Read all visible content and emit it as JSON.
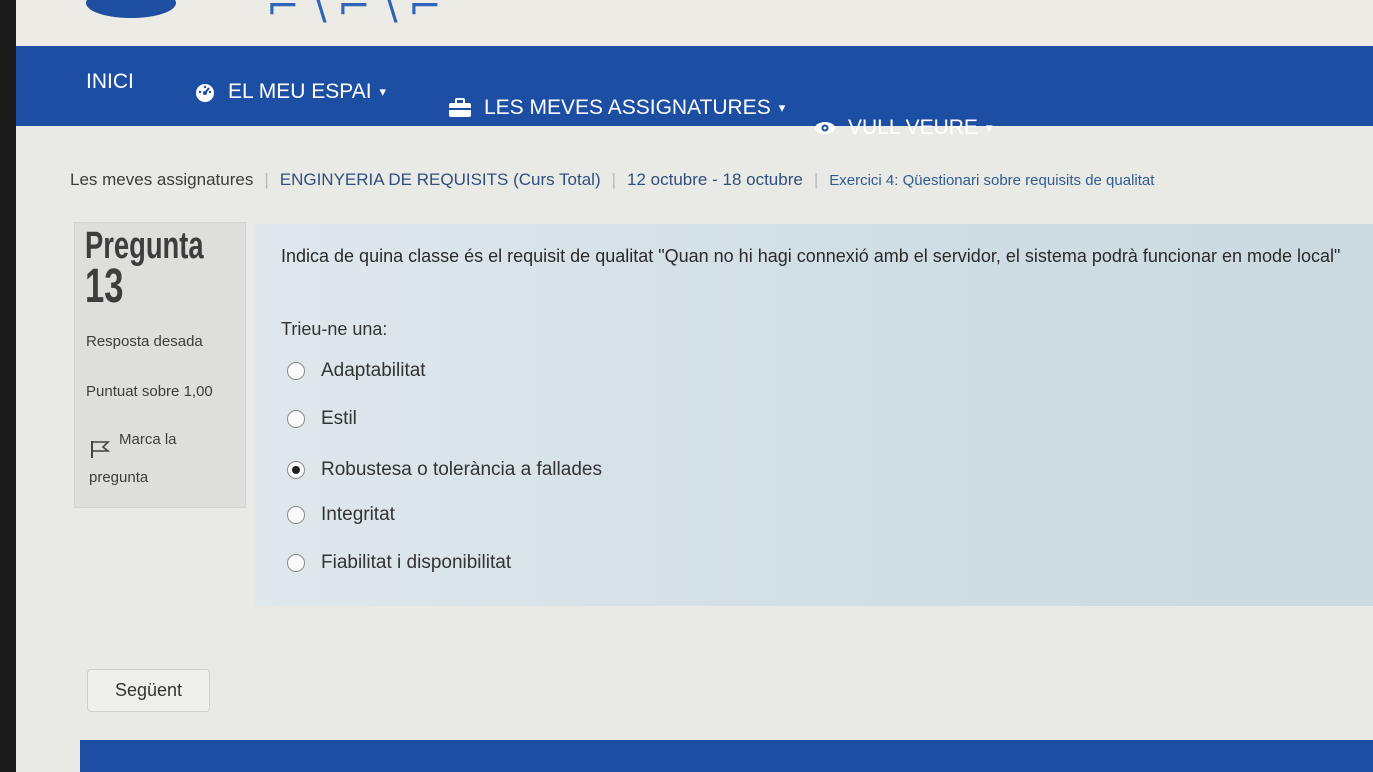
{
  "nav": {
    "items": [
      {
        "label": "INICI",
        "icon": "",
        "caret": false
      },
      {
        "label": "EL MEU ESPAI",
        "icon": "dashboard-icon",
        "caret": true
      },
      {
        "label": "LES MEVES ASSIGNATURES",
        "icon": "briefcase-icon",
        "caret": true
      },
      {
        "label": "VULL VEURE",
        "icon": "eye-icon",
        "caret": true
      }
    ],
    "caret_glyph": "▾"
  },
  "breadcrumb": [
    "Les meves assignatures",
    "ENGINYERIA DE REQUISITS (Curs Total)",
    "12 octubre - 18 octubre",
    "Exercici 4: Qüestionari sobre requisits de qualitat"
  ],
  "question_info": {
    "label": "Pregunta",
    "number": "13",
    "status": "Resposta desada",
    "grade": "Puntuat sobre 1,00",
    "flag_line1": "Marca la",
    "flag_line2": "pregunta"
  },
  "question": {
    "text": "Indica de quina classe és el requisit de qualitat \"Quan no hi hagi connexió amb el servidor, el sistema podrà funcionar en mode local\"",
    "prompt": "Trieu-ne una:",
    "options": [
      {
        "label": "Adaptabilitat",
        "selected": false
      },
      {
        "label": "Estil",
        "selected": false
      },
      {
        "label": "Robustesa o tolerància a fallades",
        "selected": true
      },
      {
        "label": "Integritat",
        "selected": false
      },
      {
        "label": "Fiabilitat i disponibilitat",
        "selected": false
      }
    ]
  },
  "buttons": {
    "next": "Següent"
  },
  "colors": {
    "navbar": "#1c4ea3",
    "content_bg": "#d6e2e8",
    "info_bg": "#dedfdd"
  }
}
